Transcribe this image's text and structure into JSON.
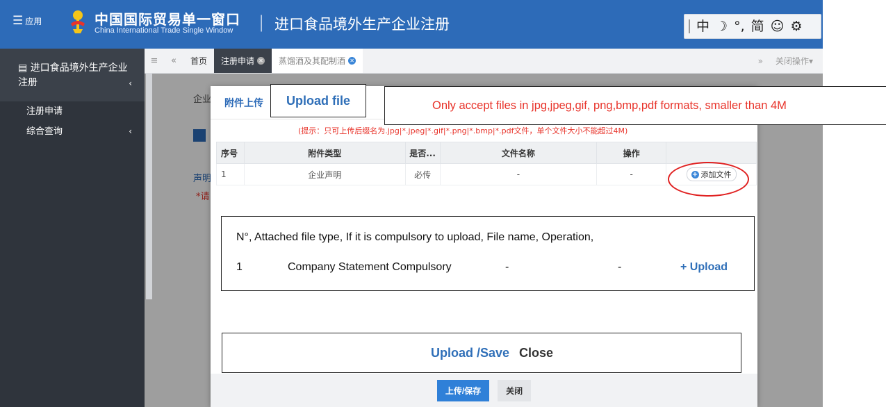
{
  "colors": {
    "topbar": "#2d6bb8",
    "sidebar": "#2f343c",
    "accent": "#2f80d8",
    "hint_red": "#e8332a"
  },
  "topbar": {
    "menu_icon": "hamburger-icon",
    "menu_label": "应用",
    "logo_icon": "customs-emblem-icon",
    "brand_cn": "中国国际贸易单一窗口",
    "brand_en": "China International Trade Single Window",
    "divider": "|",
    "system_title": "进口食品境外生产企业注册",
    "tools": {
      "lang": "中",
      "moon": "☽",
      "punct": "°,",
      "simplified": "简",
      "smile": "☺",
      "settings": "⚙"
    }
  },
  "sidebar": {
    "module_title": "进口食品境外生产企业注册",
    "items": [
      {
        "label": "注册申请"
      },
      {
        "label": "综合查询"
      }
    ]
  },
  "tabs": {
    "items": [
      {
        "label": "首页"
      },
      {
        "label": "注册申请"
      },
      {
        "label": "蒸馏酒及其配制酒"
      }
    ],
    "close_ops": "关闭操作"
  },
  "background": {
    "t1": "企业",
    "t2": "声明",
    "t3": "*请"
  },
  "modal": {
    "title": "附件上传",
    "hint": "(提示：只可上传后缀名为.jpg|*.jpeg|*.gif|*.png|*.bmp|*.pdf文件，单个文件大小不能超过4M)",
    "columns": [
      "序号",
      "附件类型",
      "是否...",
      "文件名称",
      "操作",
      ""
    ],
    "rows": [
      {
        "idx": "1",
        "type": "企业声明",
        "required": "必传",
        "filename": "-",
        "op": "-",
        "action": "添加文件"
      }
    ],
    "buttons": {
      "save": "上传/保存",
      "close": "关闭"
    }
  },
  "annotations": {
    "upload_title": "Upload file",
    "formats": "Only accept files in jpg,jpeg,gif, png,bmp,pdf formats, smaller than 4M",
    "table_header": "N°, Attached file type, If it is compulsory to upload, File name, Operation,",
    "row": {
      "idx": "1",
      "type_required": "Company Statement Compulsory",
      "filename": "-",
      "op": "-",
      "action": "+ Upload"
    },
    "buttons": {
      "save": "Upload /Save",
      "close": "Close"
    }
  }
}
